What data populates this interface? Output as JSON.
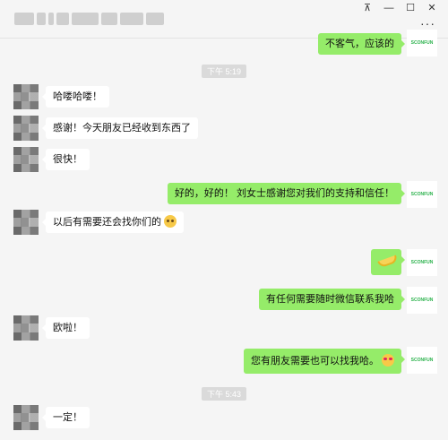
{
  "window": {
    "pin_icon": "pin-icon",
    "min_icon": "minimize-icon",
    "max_icon": "maximize-icon",
    "close_icon": "close-icon",
    "more_label": "···"
  },
  "brand_label": "SCONFUN",
  "messages": [
    {
      "side": "right",
      "text": "不客气，应该的"
    },
    {
      "side": "time",
      "text": "下午 5:19"
    },
    {
      "side": "left",
      "text": "哈喽哈喽！"
    },
    {
      "side": "left",
      "text": "感谢！今天朋友已经收到东西了"
    },
    {
      "side": "left",
      "text": "很快！"
    },
    {
      "side": "right",
      "text": "好的，好的！ 刘女士感谢您对我们的支持和信任！"
    },
    {
      "side": "left",
      "text": "以后有需要还会找你们的",
      "emoji": "thinking-face-icon"
    },
    {
      "side": "right",
      "text": "",
      "emoji": "banana-icon"
    },
    {
      "side": "right",
      "text": "有任何需要随时微信联系我哈"
    },
    {
      "side": "left",
      "text": "欧啦！"
    },
    {
      "side": "right",
      "text": "您有朋友需要也可以找我哈。",
      "emoji": "heart-eyes-face-icon"
    },
    {
      "side": "time",
      "text": "下午 5:43"
    },
    {
      "side": "left",
      "text": "一定！"
    }
  ]
}
